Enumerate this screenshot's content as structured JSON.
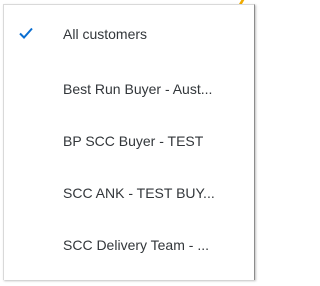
{
  "colors": {
    "accent": "#f0ab00",
    "check": "#0a6ed1",
    "text": "#32363a"
  },
  "menu": {
    "items": [
      {
        "label": "All customers",
        "selected": true,
        "icon": "check-icon"
      },
      {
        "label": "Best Run Buyer - Aust...",
        "selected": false
      },
      {
        "label": "BP SCC Buyer - TEST",
        "selected": false
      },
      {
        "label": "SCC ANK - TEST BUY...",
        "selected": false
      },
      {
        "label": "SCC Delivery Team - ...",
        "selected": false
      }
    ]
  }
}
